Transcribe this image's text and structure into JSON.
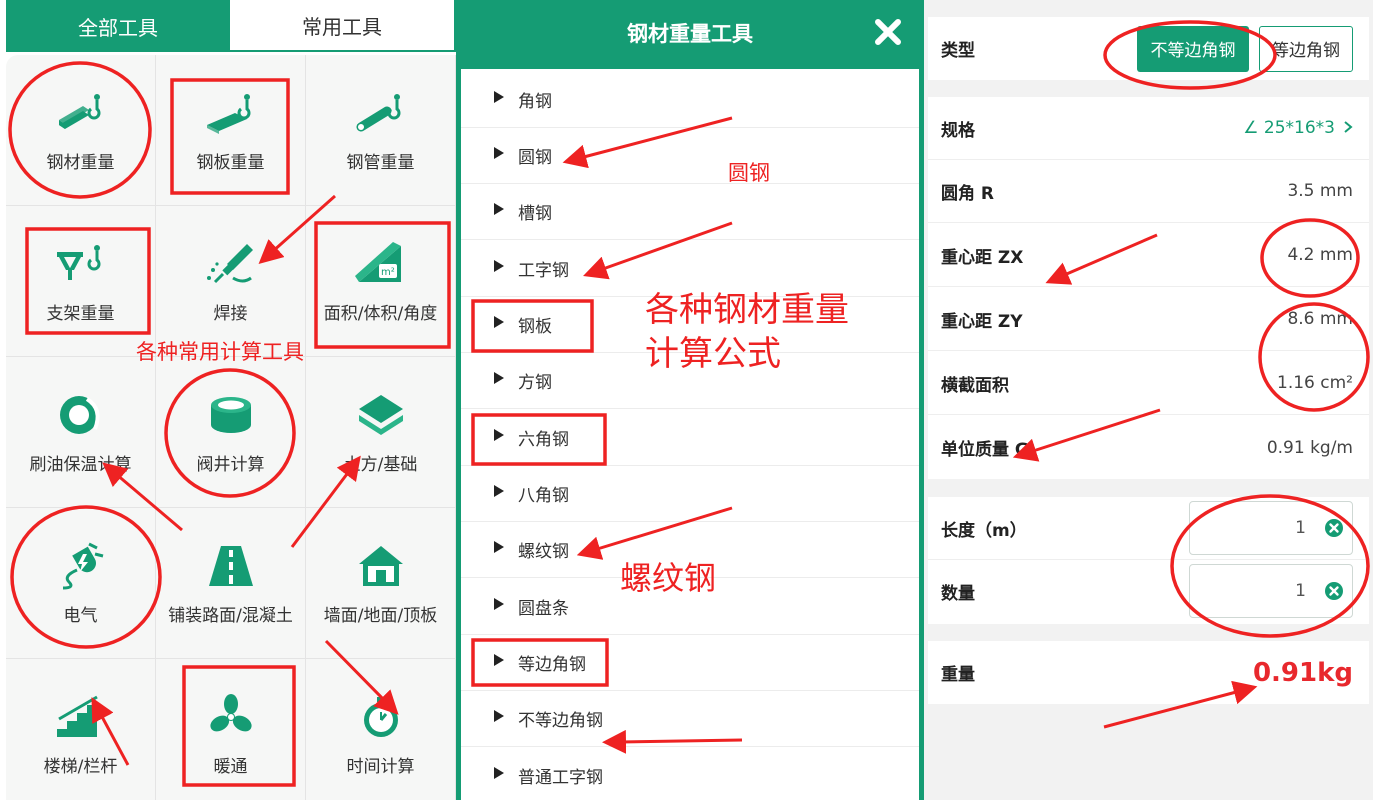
{
  "tools_panel": {
    "tabs": [
      {
        "label": "全部工具",
        "active": true
      },
      {
        "label": "常用工具",
        "active": false
      }
    ],
    "items": [
      {
        "label": "钢材重量",
        "icon": "steel-bar-hook-icon"
      },
      {
        "label": "钢板重量",
        "icon": "steel-plate-hook-icon"
      },
      {
        "label": "钢管重量",
        "icon": "steel-pipe-hook-icon"
      },
      {
        "label": "支架重量",
        "icon": "bracket-hook-icon"
      },
      {
        "label": "焊接",
        "icon": "welding-torch-icon"
      },
      {
        "label": "面积/体积/角度",
        "icon": "ruler-area-icon"
      },
      {
        "label": "刷油保温计算",
        "icon": "pipe-insulation-icon"
      },
      {
        "label": "阀井计算",
        "icon": "valve-well-icon"
      },
      {
        "label": "土方/基础",
        "icon": "earthwork-layers-icon"
      },
      {
        "label": "电气",
        "icon": "electric-plug-icon"
      },
      {
        "label": "铺装路面/混凝土",
        "icon": "road-paving-icon"
      },
      {
        "label": "墙面/地面/顶板",
        "icon": "house-icon"
      },
      {
        "label": "楼梯/栏杆",
        "icon": "stairs-icon"
      },
      {
        "label": "暖通",
        "icon": "fan-icon"
      },
      {
        "label": "时间计算",
        "icon": "stopwatch-icon"
      }
    ]
  },
  "steel_panel": {
    "title": "钢材重量工具",
    "items": [
      "角钢",
      "圆钢",
      "槽钢",
      "工字钢",
      "钢板",
      "方钢",
      "六角钢",
      "八角钢",
      "螺纹钢",
      "圆盘条",
      "等边角钢",
      "不等边角钢",
      "普通工字钢"
    ]
  },
  "detail_panel": {
    "type_label": "类型",
    "type_options": [
      {
        "label": "不等边角钢",
        "selected": true
      },
      {
        "label": "等边角钢",
        "selected": false
      }
    ],
    "spec_label": "规格",
    "spec_value": "∠ 25*16*3",
    "props": [
      {
        "label": "圆角 R",
        "value": "3.5 mm"
      },
      {
        "label": "重心距 ZX",
        "value": "4.2 mm"
      },
      {
        "label": "重心距 ZY",
        "value": "8.6 mm"
      },
      {
        "label": "横截面积",
        "value": "1.16 cm²"
      },
      {
        "label": "单位质量 G",
        "value": "0.91 kg/m"
      }
    ],
    "inputs": [
      {
        "label": "长度（m）",
        "value": "1"
      },
      {
        "label": "数量",
        "value": "1"
      }
    ],
    "result_label": "重量",
    "result_value": "0.91kg"
  },
  "annotations": {
    "tools": "各种常用计算工具",
    "round_steel": "圆钢",
    "formula_line1": "各种钢材重量",
    "formula_line2": "计算公式",
    "rebar": "螺纹钢"
  },
  "colors": {
    "brand": "#159c74",
    "annotation": "#ee2222",
    "result": "#e8282d"
  }
}
